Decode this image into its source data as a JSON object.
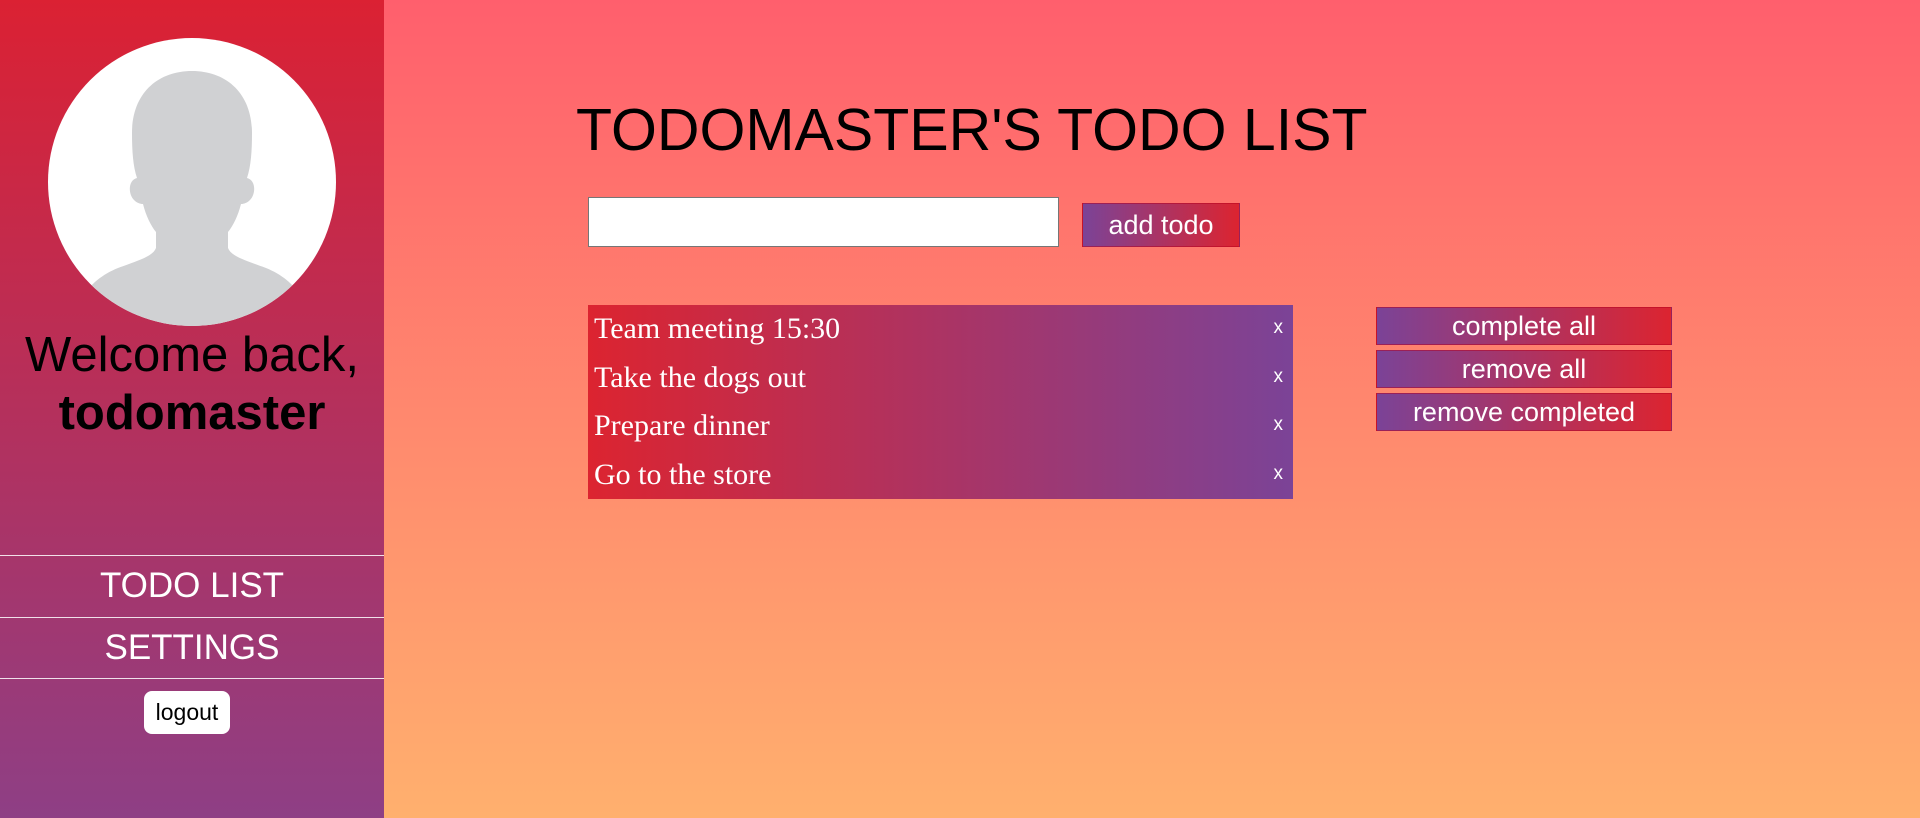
{
  "sidebar": {
    "welcome_text": "Welcome back,",
    "username": "todomaster",
    "nav": [
      {
        "label": "TODO LIST"
      },
      {
        "label": "SETTINGS"
      }
    ],
    "logout_label": "logout"
  },
  "main": {
    "title": "TODOMASTER'S TODO LIST",
    "input_value": "",
    "add_button_label": "add todo",
    "todos": [
      {
        "text": "Team meeting 15:30",
        "remove_label": "x"
      },
      {
        "text": "Take the dogs out",
        "remove_label": "x"
      },
      {
        "text": "Prepare dinner",
        "remove_label": "x"
      },
      {
        "text": "Go to the store",
        "remove_label": "x"
      }
    ],
    "actions": {
      "complete_all": "complete all",
      "remove_all": "remove all",
      "remove_completed": "remove completed"
    }
  },
  "colors": {
    "sidebar_top": "#db2133",
    "sidebar_bottom": "#8e3f85",
    "page_top": "#ff5f6d",
    "page_bottom": "#ffb06e",
    "accent_purple": "#7b4397",
    "accent_red": "#dc2430"
  },
  "icons": {
    "avatar": "user-silhouette-icon"
  }
}
